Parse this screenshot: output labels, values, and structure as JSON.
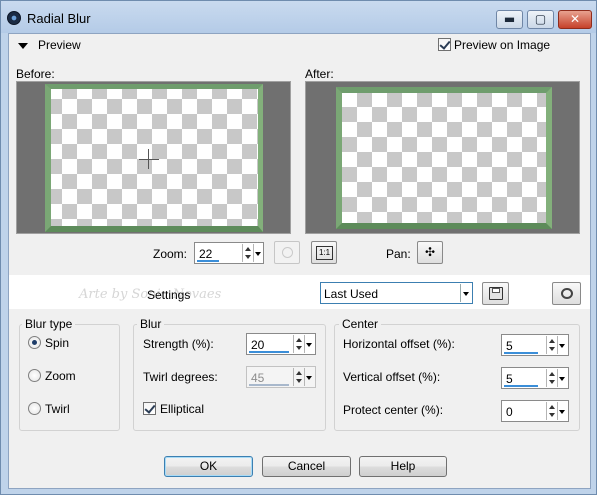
{
  "window": {
    "title": "Radial Blur",
    "minimize_glyph": "▬",
    "maximize_glyph": "▢",
    "close_glyph": "✕",
    "accent": "#3c7fb1"
  },
  "preview": {
    "toggle_label": "Preview",
    "preview_on_image_label": "Preview on Image",
    "preview_on_image_checked": true,
    "before_label": "Before:",
    "after_label": "After:",
    "zoom_label": "Zoom:",
    "zoom_value": "22",
    "pan_label": "Pan:",
    "actual_size_glyph": "1:1",
    "pan_glyph": "✣"
  },
  "presets": {
    "watermark": "Arte by Sonia Novaes",
    "settings_label": "Settings",
    "selected": "Last Used"
  },
  "blur_type": {
    "title": "Blur type",
    "options": [
      "Spin",
      "Zoom",
      "Twirl"
    ],
    "selected": "Spin"
  },
  "blur": {
    "title": "Blur",
    "strength_label": "Strength (%):",
    "strength_value": "20",
    "twirl_label": "Twirl degrees:",
    "twirl_value": "45",
    "elliptical_label": "Elliptical",
    "elliptical_checked": true
  },
  "center": {
    "title": "Center",
    "h_offset_label": "Horizontal offset (%):",
    "h_offset_value": "5",
    "v_offset_label": "Vertical offset (%):",
    "v_offset_value": "5",
    "protect_label": "Protect center (%):",
    "protect_value": "0"
  },
  "buttons": {
    "ok": "OK",
    "cancel": "Cancel",
    "help": "Help"
  }
}
